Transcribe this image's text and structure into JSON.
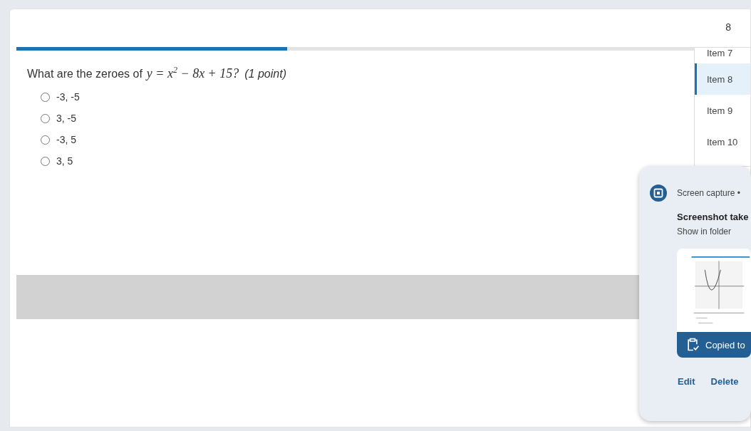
{
  "page_number": "8",
  "progress": {
    "level": 0.4
  },
  "question": {
    "text": "What are the zeroes of",
    "math": "y = x$^{2}$ − 8x + 15?",
    "points": "(1 point)"
  },
  "options": [
    {
      "label": "-3, -5",
      "selected": false
    },
    {
      "label": "3, -5",
      "selected": false
    },
    {
      "label": "-3, 5",
      "selected": false
    },
    {
      "label": "3, 5",
      "selected": false
    }
  ],
  "item_list": [
    {
      "label": "Item 7",
      "selected": false
    },
    {
      "label": "Item 8",
      "selected": true
    },
    {
      "label": "Item 9",
      "selected": false
    },
    {
      "label": "Item 10",
      "selected": false
    }
  ],
  "notification": {
    "source": "Screen capture •",
    "title": "Screenshot take",
    "link": "Show in folder",
    "banner": "Copied to",
    "actions": [
      "Edit",
      "Delete"
    ]
  }
}
